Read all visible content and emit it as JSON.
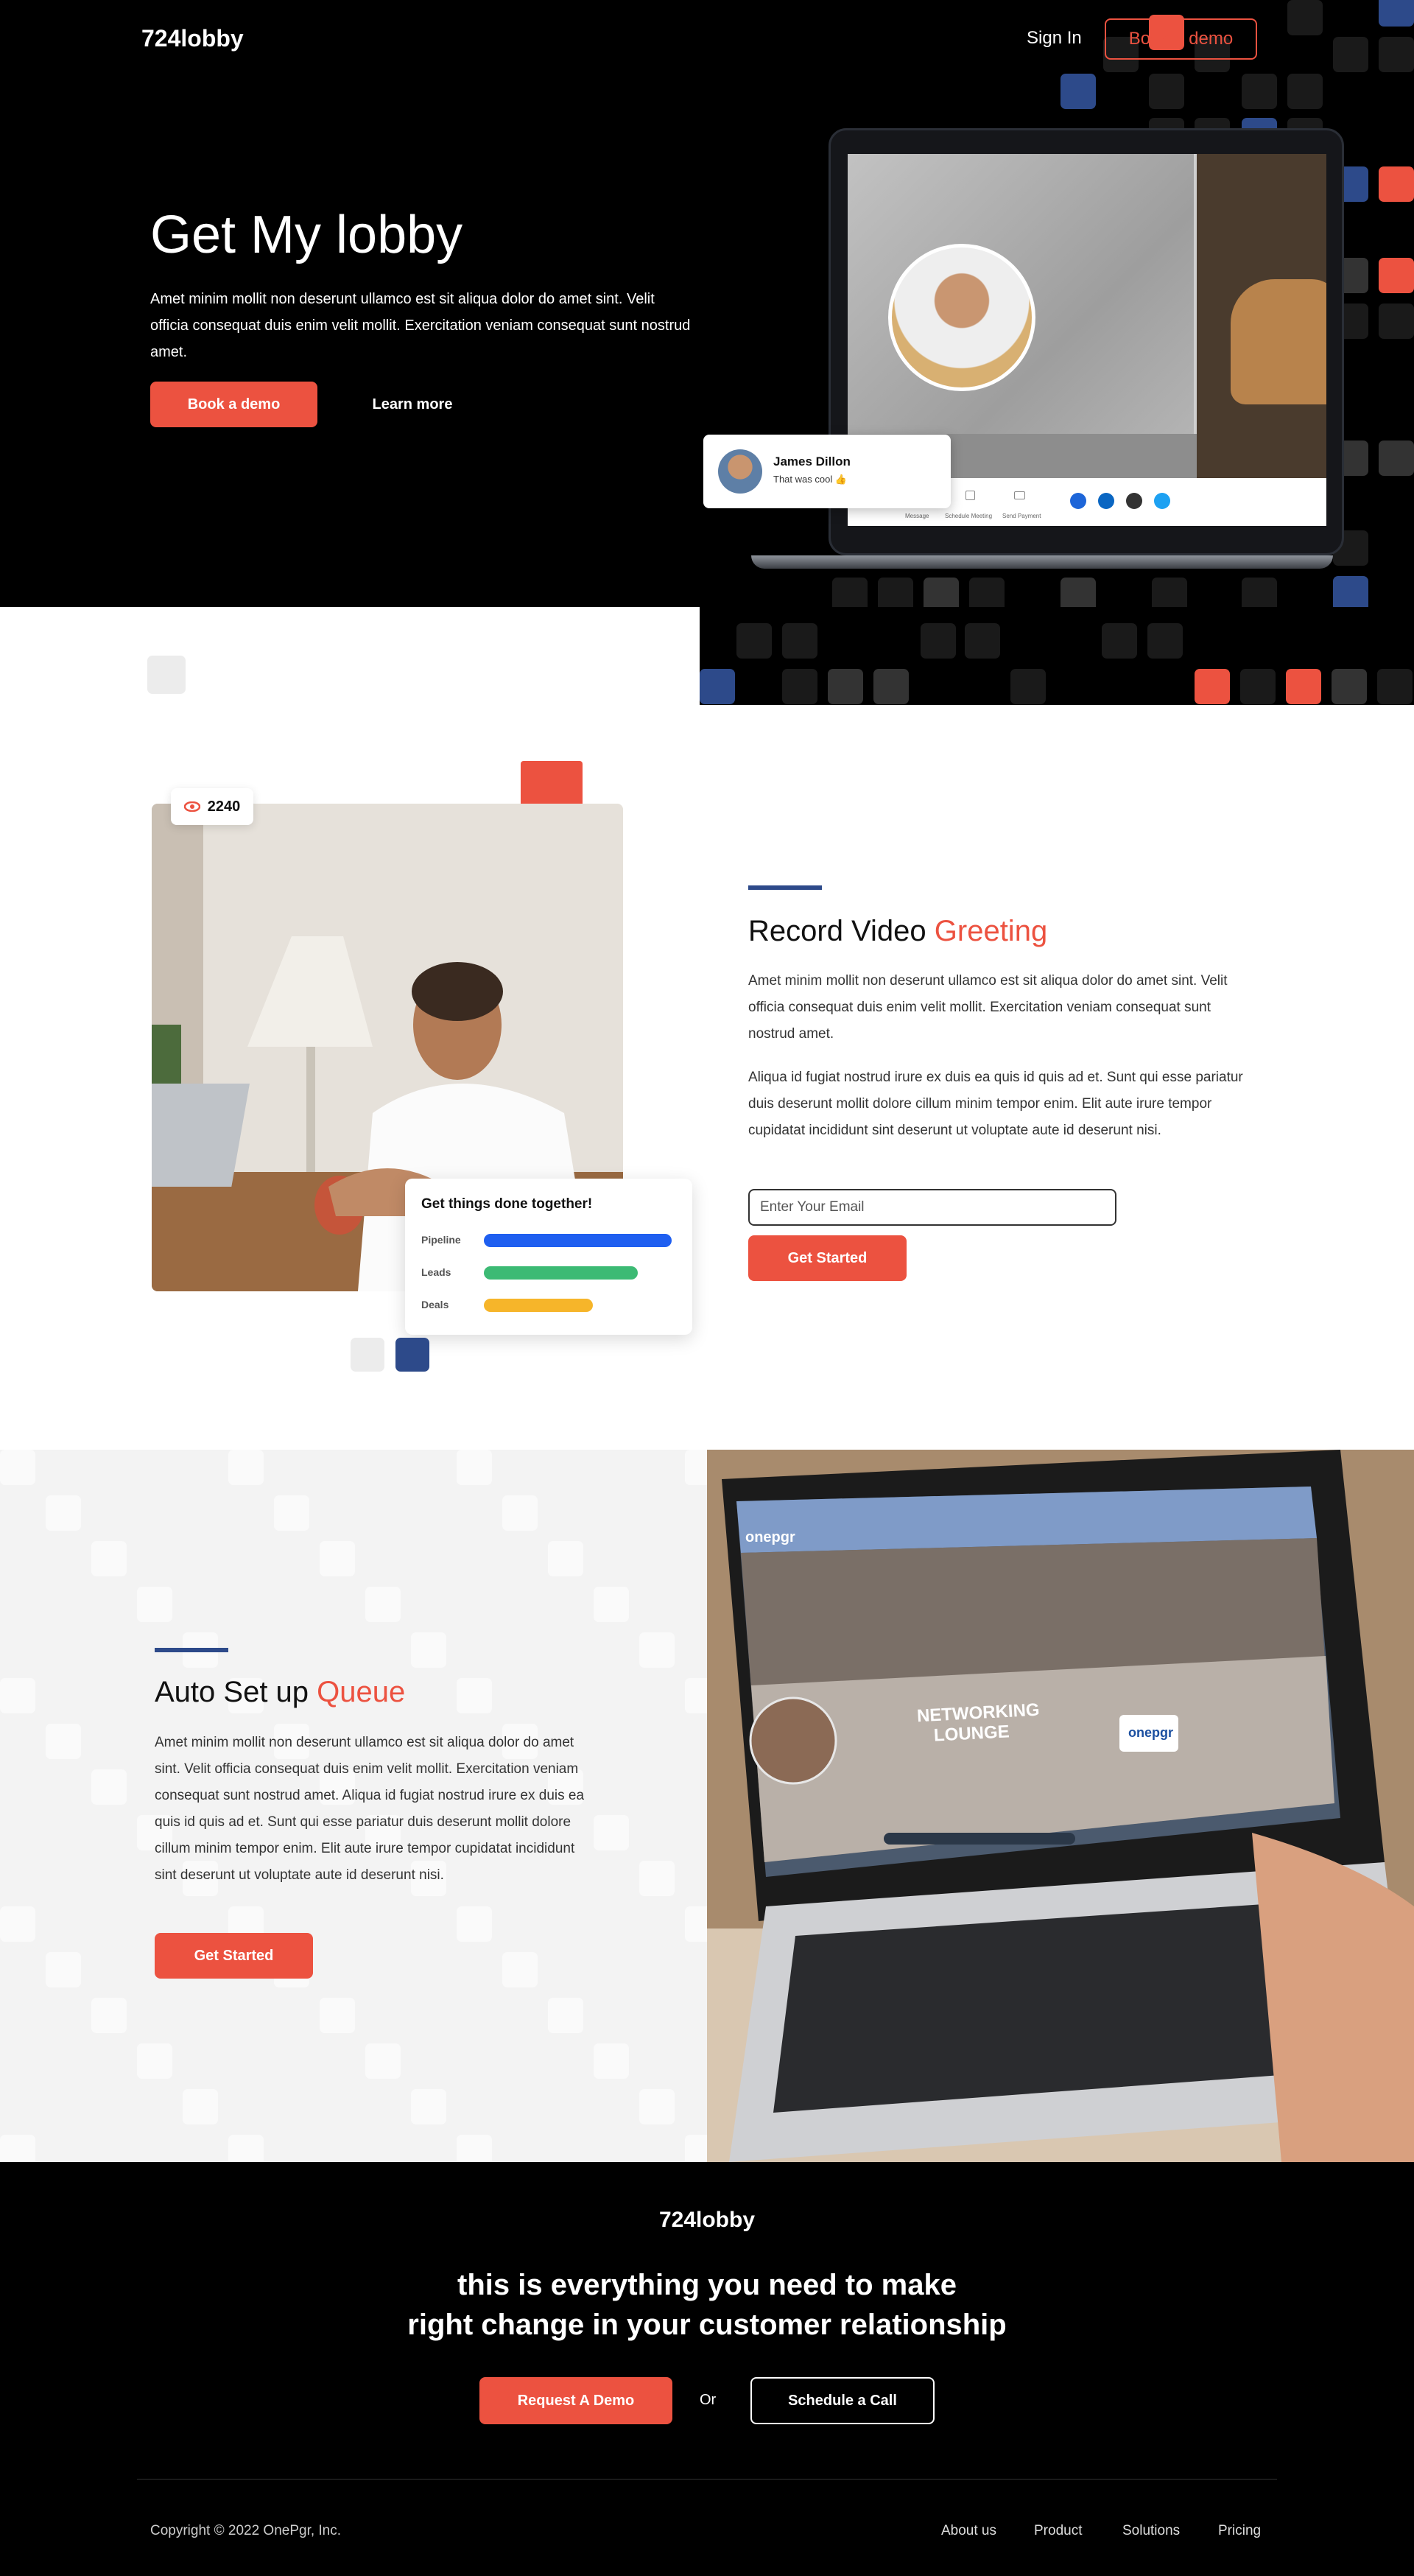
{
  "header": {
    "logo": "724lobby",
    "sign_in": "Sign In",
    "book_demo": "Book a demo"
  },
  "hero": {
    "title": "Get My lobby",
    "text": "Amet minim mollit non deserunt ullamco est sit aliqua dolor do amet sint. Velit officia consequat duis enim velit mollit. Exercitation veniam consequat sunt nostrud amet.",
    "primary_button": "Book a demo",
    "secondary_button": "Learn more",
    "chat": {
      "name": "James Dillon",
      "message": "That was cool 👍"
    },
    "meeting_bar": [
      "Message",
      "Schedule Meeting",
      "Send Payment"
    ]
  },
  "greeting": {
    "views": "2240",
    "title_plain": "Record Video ",
    "title_accent": "Greeting",
    "para1": "Amet minim mollit non deserunt ullamco est sit aliqua dolor do amet sint. Velit officia consequat duis enim velit mollit. Exercitation veniam consequat sunt nostrud amet.",
    "para2": "Aliqua id fugiat nostrud irure ex duis ea quis id quis ad et. Sunt qui esse pariatur duis deserunt mollit dolore cillum minim tempor enim. Elit aute irure tempor cupidatat incididunt sint deserunt ut voluptate aute id deserunt nisi.",
    "email_placeholder": "Enter Your Email",
    "button": "Get Started",
    "tasks": {
      "title": "Get things done together!",
      "rows": [
        {
          "label": "Pipeline",
          "fraction": 1.0,
          "color": "#1f5ff0"
        },
        {
          "label": "Leads",
          "fraction": 0.82,
          "color": "#3cba74"
        },
        {
          "label": "Deals",
          "fraction": 0.58,
          "color": "#f6b52a"
        }
      ]
    }
  },
  "queue": {
    "title_plain": "Auto Set up ",
    "title_accent": "Queue",
    "para": "Amet minim mollit non deserunt ullamco est sit aliqua dolor do amet sint. Velit officia consequat duis enim velit mollit. Exercitation veniam consequat sunt nostrud amet. Aliqua id fugiat nostrud irure ex duis ea quis id quis ad et. Sunt qui esse pariatur duis deserunt mollit dolore cillum minim tempor enim. Elit aute irure tempor cupidatat incididunt sint deserunt ut voluptate aute id deserunt nisi.",
    "button": "Get Started",
    "screen": {
      "brand": "onepgr",
      "room_line1": "NETWORKING",
      "room_line2": "LOUNGE",
      "sign": "onepgr"
    }
  },
  "footer": {
    "logo": "724lobby",
    "headline_line1": "this is everything you need to make",
    "headline_line2": "right change in your customer relationship",
    "request_demo": "Request A Demo",
    "or": "Or",
    "schedule_call": "Schedule a Call",
    "copyright": "Copyright © 2022 OnePgr, Inc.",
    "links": [
      "About us",
      "Product",
      "Solutions",
      "Pricing"
    ]
  },
  "colors": {
    "accent": "#ec5240",
    "navy": "#2d4a8a",
    "black": "#000000"
  }
}
